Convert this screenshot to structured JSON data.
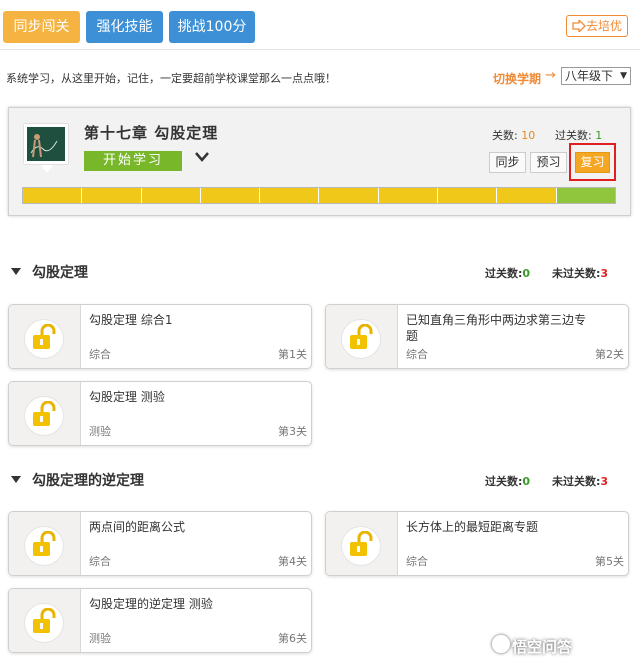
{
  "tabs": {
    "sync": "同步闯关",
    "skill": "强化技能",
    "challenge": "挑战100分"
  },
  "header": {
    "kantanyou": "去培优"
  },
  "hint": "系统学习，从这里开始，记住，一定要超前学校课堂那么一点点哦！",
  "term": {
    "switch_label": "切换学期",
    "arrow": "→",
    "grade": "八年级下"
  },
  "chapter": {
    "title": "第十七章  勾股定理",
    "start": "开始学习",
    "level_label": "关数: ",
    "level_count": "10",
    "passed_label": "过关数: ",
    "passed_count": "1",
    "modes": {
      "sync": "同步",
      "preview": "预习",
      "review": "复习"
    },
    "progress": {
      "segments": 10,
      "completed": 1
    }
  },
  "sections": [
    {
      "title": "勾股定理",
      "passed_label": "过关数:",
      "passed": "0",
      "unpassed_label": "未过关数:",
      "unpassed": "3",
      "lessons": [
        {
          "title": "勾股定理 综合1",
          "kind": "综合",
          "no": "第1关"
        },
        {
          "title": "已知直角三角形中两边求第三边专题",
          "kind": "综合",
          "no": "第2关"
        },
        {
          "title": "勾股定理 测验",
          "kind": "测验",
          "no": "第3关"
        }
      ]
    },
    {
      "title": "勾股定理的逆定理",
      "passed_label": "过关数:",
      "passed": "0",
      "unpassed_label": "未过关数:",
      "unpassed": "3",
      "lessons": [
        {
          "title": "两点间的距离公式",
          "kind": "综合",
          "no": "第4关"
        },
        {
          "title": "长方体上的最短距离专题",
          "kind": "综合",
          "no": "第5关"
        },
        {
          "title": "勾股定理的逆定理 测验",
          "kind": "测验",
          "no": "第6关"
        }
      ]
    }
  ],
  "watermark": "悟空问答",
  "colors": {
    "orange": "#f5b342",
    "blue": "#3d8fd6",
    "green": "#79b72a",
    "bar_yellow": "#f0c81a",
    "bar_green": "#8fc63e",
    "highlight_red": "#e02020"
  }
}
